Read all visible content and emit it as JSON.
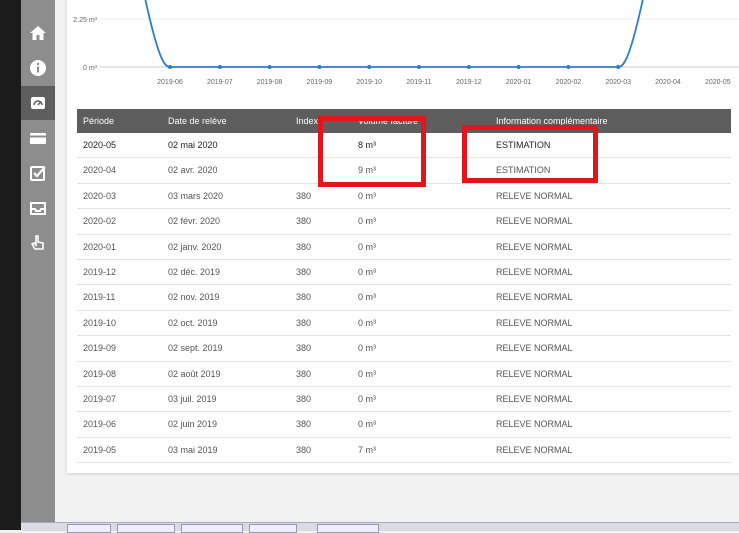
{
  "sidebar": {
    "items": [
      {
        "icon": "home-icon",
        "active": false
      },
      {
        "icon": "info-icon",
        "active": false
      },
      {
        "icon": "gauge-icon",
        "active": true
      },
      {
        "icon": "card-icon",
        "active": false
      },
      {
        "icon": "checklist-icon",
        "active": false
      },
      {
        "icon": "inbox-icon",
        "active": false
      },
      {
        "icon": "pointer-hand-icon",
        "active": false
      }
    ]
  },
  "chart_data": {
    "type": "line",
    "categories": [
      "2019-06",
      "2019-07",
      "2019-08",
      "2019-09",
      "2019-10",
      "2019-11",
      "2019-12",
      "2020-01",
      "2020-02",
      "2020-03",
      "2020-04",
      "2020-05"
    ],
    "values": [
      0,
      0,
      0,
      0,
      0,
      0,
      0,
      0,
      0,
      0,
      null,
      null
    ],
    "y_tick_labels": [
      "2.25 m³",
      "0 m³"
    ],
    "y_ticks": [
      2.25,
      0
    ],
    "color": "#2e7dc7"
  },
  "table": {
    "headers": [
      "Période",
      "Date de relève",
      "Index",
      "Volume facturé",
      "Information complémentaire"
    ],
    "rows": [
      [
        "2020-05",
        "02 mai 2020",
        "",
        "8 m³",
        "ESTIMATION"
      ],
      [
        "2020-04",
        "02 avr. 2020",
        "",
        "9 m³",
        "ESTIMATION"
      ],
      [
        "2020-03",
        "03 mars 2020",
        "380",
        "0 m³",
        "RELEVE NORMAL"
      ],
      [
        "2020-02",
        "02 févr. 2020",
        "380",
        "0 m³",
        "RELEVE NORMAL"
      ],
      [
        "2020-01",
        "02 janv. 2020",
        "380",
        "0 m³",
        "RELEVE NORMAL"
      ],
      [
        "2019-12",
        "02 déc. 2019",
        "380",
        "0 m³",
        "RELEVE NORMAL"
      ],
      [
        "2019-11",
        "02 nov. 2019",
        "380",
        "0 m³",
        "RELEVE NORMAL"
      ],
      [
        "2019-10",
        "02 oct. 2019",
        "380",
        "0 m³",
        "RELEVE NORMAL"
      ],
      [
        "2019-09",
        "02 sept. 2019",
        "380",
        "0 m³",
        "RELEVE NORMAL"
      ],
      [
        "2019-08",
        "02 août 2019",
        "380",
        "0 m³",
        "RELEVE NORMAL"
      ],
      [
        "2019-07",
        "03 juil. 2019",
        "380",
        "0 m³",
        "RELEVE NORMAL"
      ],
      [
        "2019-06",
        "02 juin 2019",
        "380",
        "0 m³",
        "RELEVE NORMAL"
      ],
      [
        "2019-05",
        "03 mai 2019",
        "380",
        "7 m³",
        "RELEVE NORMAL"
      ]
    ]
  },
  "colors": {
    "header_bg": "#5d5d5d",
    "annotation": "#e4141b",
    "sidebar": "#8d8d8d",
    "line": "#2e7dc7"
  }
}
